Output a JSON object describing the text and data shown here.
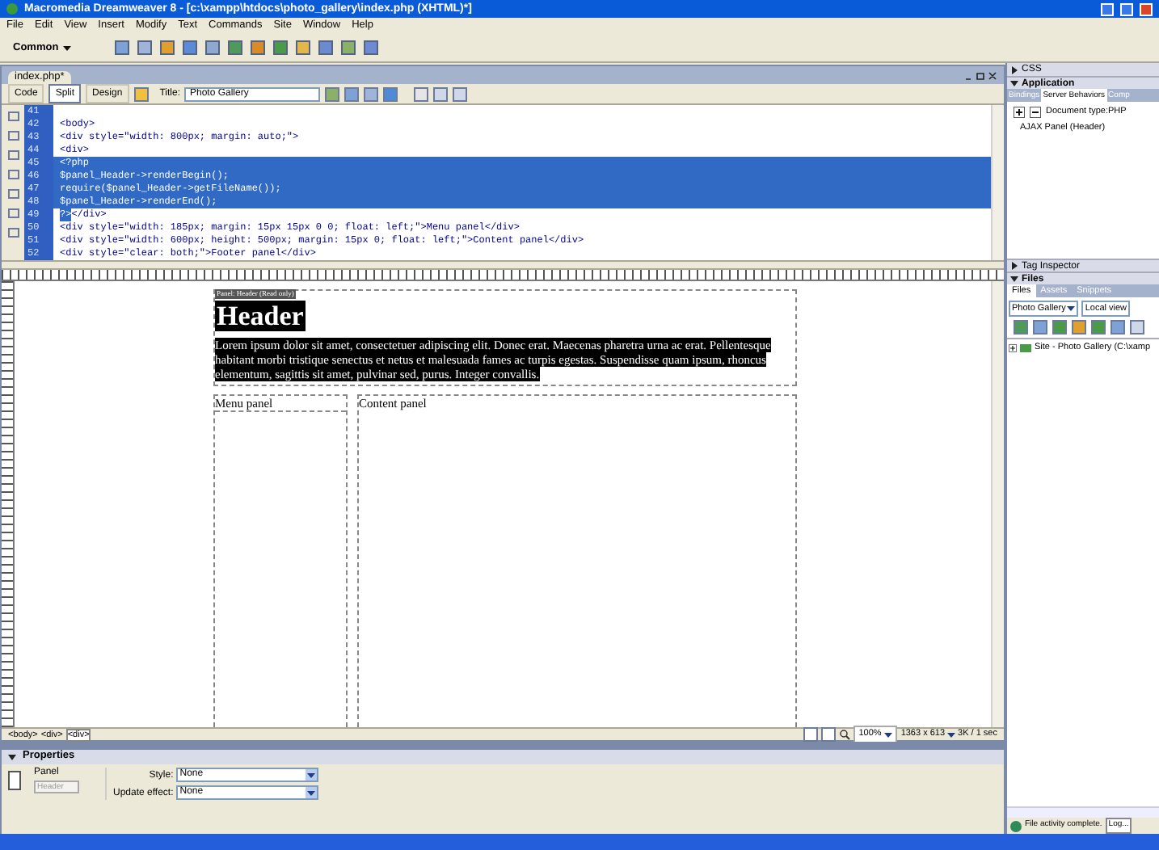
{
  "window": {
    "title": "Macromedia Dreamweaver 8 - [c:\\xampp\\htdocs\\photo_gallery\\index.php (XHTML)*]"
  },
  "menu": [
    "File",
    "Edit",
    "View",
    "Insert",
    "Modify",
    "Text",
    "Commands",
    "Site",
    "Window",
    "Help"
  ],
  "insert_bar": {
    "category": "Common"
  },
  "document": {
    "tab": "index.php*",
    "view_buttons": [
      {
        "label": "Code",
        "selected": false
      },
      {
        "label": "Split",
        "selected": true
      },
      {
        "label": "Design",
        "selected": false
      }
    ],
    "title_label": "Title:",
    "title_value": "Photo Gallery",
    "code_lines": [
      {
        "number": "41"
      },
      {
        "number": "42",
        "segments": [
          {
            "text": "<body>",
            "selected": false
          }
        ]
      },
      {
        "number": "43",
        "segments": [
          {
            "text": "<div style=\"width: 800px; margin: auto;\">",
            "selected": false
          }
        ]
      },
      {
        "number": "44",
        "segments": [
          {
            "text": "<div>",
            "selected": false
          }
        ]
      },
      {
        "number": "45",
        "segments": [
          {
            "text": "<?php",
            "selected": true
          }
        ]
      },
      {
        "number": "46",
        "segments": [
          {
            "text": "$panel_Header->renderBegin();",
            "selected": true
          }
        ]
      },
      {
        "number": "47",
        "segments": [
          {
            "text": "require($panel_Header->getFileName());",
            "selected": true
          }
        ]
      },
      {
        "number": "48",
        "segments": [
          {
            "text": "$panel_Header->renderEnd();",
            "selected": true
          }
        ]
      },
      {
        "number": "49",
        "segments": [
          {
            "text": "?>",
            "selected": true
          },
          {
            "text": "</div>",
            "selected": false
          }
        ]
      },
      {
        "number": "50",
        "segments": [
          {
            "text": "<div style=\"width: 185px; margin: 15px 15px 0 0; float: left;\">Menu panel</div>",
            "selected": false
          }
        ]
      },
      {
        "number": "51",
        "segments": [
          {
            "text": "<div style=\"width: 600px; height: 500px; margin: 15px 0; float: left;\">Content panel</div>",
            "selected": false
          }
        ]
      },
      {
        "number": "52",
        "segments": [
          {
            "text": "<div style=\"clear: both;\">Footer panel</div>",
            "selected": false
          }
        ]
      }
    ],
    "design": {
      "panel_label": "Panel: Header (Read only)",
      "header": "Header",
      "paragraph": "Lorem ipsum dolor sit amet, consectetuer adipiscing elit. Donec erat. Maecenas pharetra urna ac erat. Pellentesque habitant morbi tristique senectus et netus et malesuada fames ac turpis egestas. Suspendisse quam ipsum, rhoncus elementum, sagittis sit amet, pulvinar sed, purus. Integer convallis.",
      "menu_panel": "Menu panel",
      "content_panel": "Content panel"
    },
    "tag_selector": [
      {
        "label": "<body>",
        "selected": false
      },
      {
        "label": "<div>",
        "selected": false
      },
      {
        "label": "<div>",
        "selected": true
      }
    ],
    "status": {
      "zoom": "100%",
      "size": "1363 x 613",
      "download": "3K / 1 sec"
    }
  },
  "properties": {
    "title": "Properties",
    "element": "Panel",
    "name_placeholder": "Header",
    "fields": [
      {
        "label": "Style:",
        "value": "None"
      },
      {
        "label": "Update effect:",
        "value": "None"
      }
    ]
  },
  "panels": {
    "css": {
      "title": "CSS",
      "expanded": false
    },
    "application": {
      "title": "Application",
      "expanded": true,
      "tabs": [
        {
          "label": "Bindings",
          "selected": false
        },
        {
          "label": "Server Behaviors",
          "selected": true
        },
        {
          "label": "Comp",
          "selected": false
        }
      ],
      "document_type": "Document type:PHP",
      "items": [
        "AJAX Panel (Header)"
      ]
    },
    "tag_inspector": {
      "title": "Tag Inspector",
      "expanded": false
    },
    "files": {
      "title": "Files",
      "expanded": true,
      "tabs": [
        {
          "label": "Files",
          "selected": true
        },
        {
          "label": "Assets",
          "selected": false
        },
        {
          "label": "Snippets",
          "selected": false
        }
      ],
      "site": "Photo Gallery",
      "view": "Local view",
      "tree": [
        {
          "label": "Site - Photo Gallery (C:\\xamp"
        }
      ],
      "status": "File activity complete.",
      "log_button": "Log..."
    }
  }
}
